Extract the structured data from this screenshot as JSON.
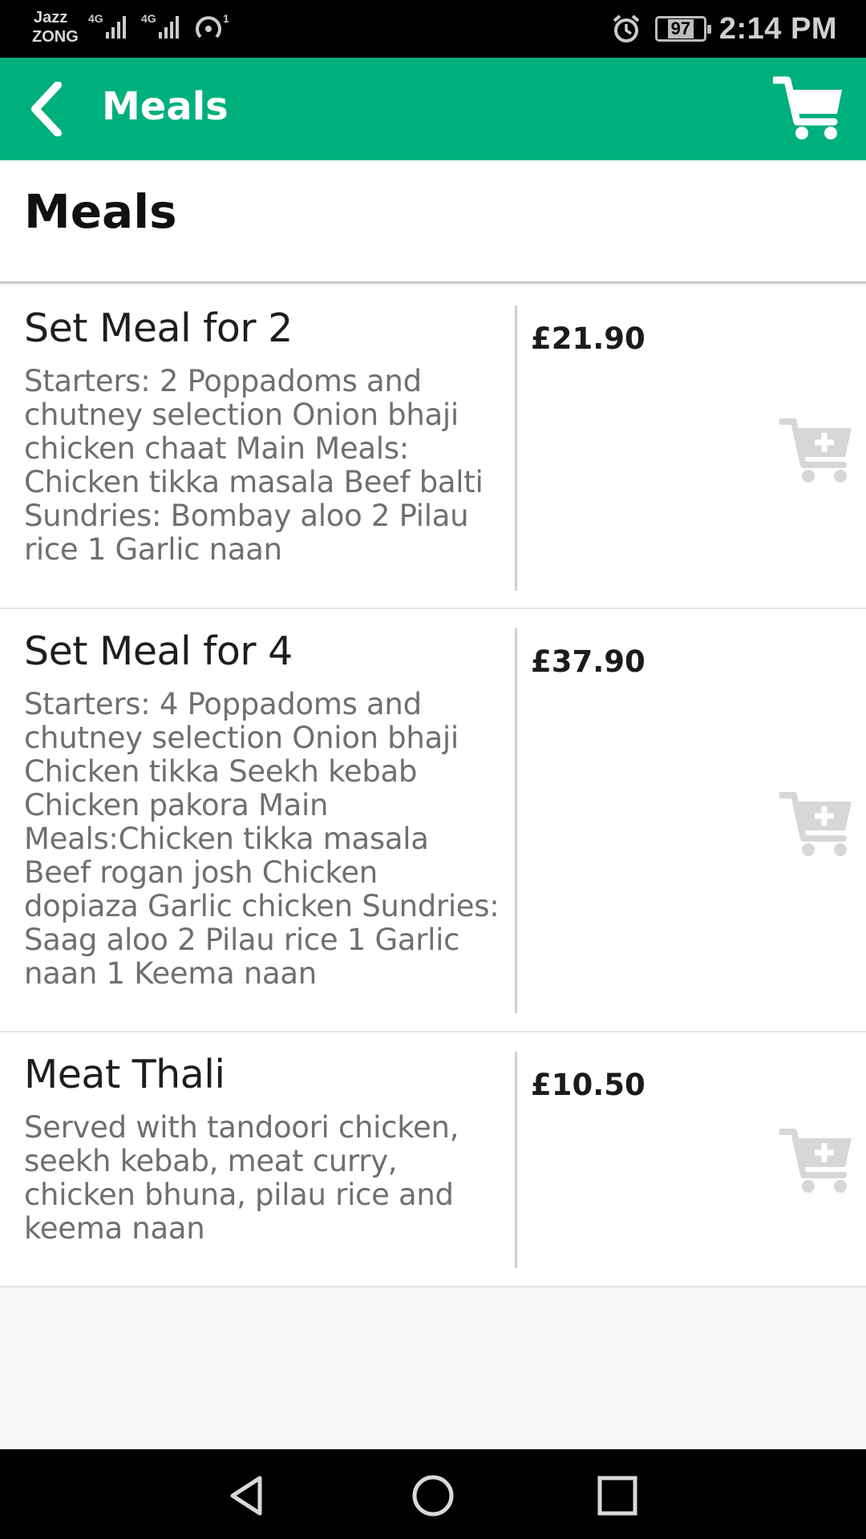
{
  "status_bar": {
    "carrier_1": "Jazz",
    "carrier_2": "ZONG",
    "battery": "97",
    "time": "2:14 PM",
    "icons": [
      "signal-4g-icon",
      "signal-4g-icon",
      "hotspot-icon",
      "alarm-icon",
      "battery-icon"
    ]
  },
  "app_bar": {
    "title": "Meals",
    "back_icon": "chevron-left-icon",
    "cart_icon": "shopping-cart-icon",
    "color": "#00b07c"
  },
  "page": {
    "heading": "Meals"
  },
  "meals": [
    {
      "name": "Set Meal for 2",
      "description_lines": [
        "Starters: 2 Poppadoms and",
        "chutney selection Onion bhaji",
        "chicken chaat Main Meals:",
        "Chicken tikka masala Beef balti",
        "Sundries: Bombay aloo 2 Pilau",
        "rice 1 Garlic naan"
      ],
      "price": "£21.90"
    },
    {
      "name": "Set Meal for 4",
      "description_lines": [
        "Starters: 4 Poppadoms and",
        "chutney selection Onion bhaji",
        "Chicken tikka Seekh kebab",
        "Chicken pakora Main",
        "Meals:Chicken tikka masala",
        "Beef rogan josh Chicken",
        "dopiaza Garlic chicken Sundries:",
        "Saag aloo 2 Pilau rice 1 Garlic",
        "naan 1 Keema naan"
      ],
      "price": "£37.90"
    },
    {
      "name": "Meat Thali",
      "description_lines": [
        "Served with tandoori chicken,",
        "seekh kebab, meat curry,",
        "chicken bhuna, pilau rice and",
        "keema naan"
      ],
      "price": "£10.50"
    }
  ],
  "nav_bar": {
    "icons": [
      "back-triangle-icon",
      "home-circle-icon",
      "recents-square-icon"
    ]
  }
}
